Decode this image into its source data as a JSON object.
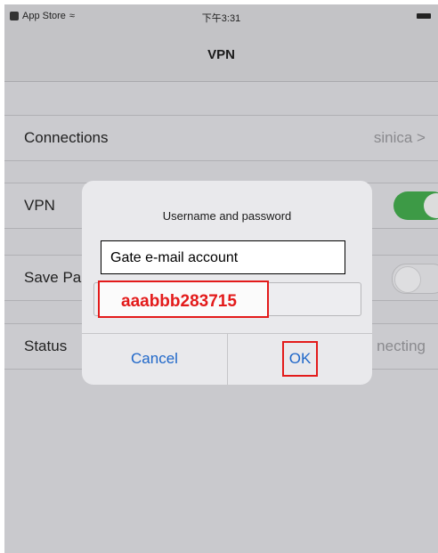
{
  "status_bar": {
    "carrier": "App Store",
    "time": "下午3:31"
  },
  "nav": {
    "title": "VPN"
  },
  "rows": {
    "connections": {
      "label": "Connections",
      "value": "sinica >"
    },
    "vpn": {
      "label": "VPN",
      "toggle": "on"
    },
    "save_password": {
      "label": "Save Pa",
      "toggle": "off"
    },
    "status": {
      "label": "Status",
      "value": "necting"
    }
  },
  "dialog": {
    "title": "Username and password",
    "username_value": "Gate e-mail account",
    "password_value": "aaabbb283715",
    "cancel_label": "Cancel",
    "ok_label": "OK"
  },
  "colors": {
    "annotation": "#e31b1b",
    "toggle_on": "#3d9a46",
    "button_text": "#1f67c9"
  }
}
